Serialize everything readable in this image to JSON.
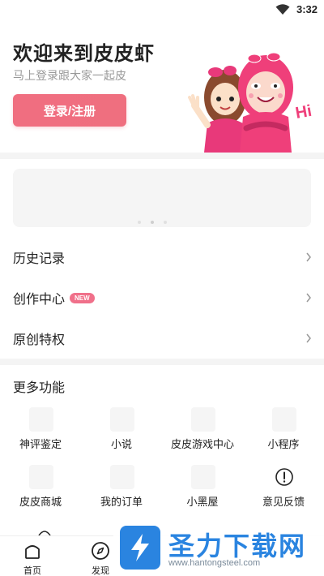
{
  "status_bar": {
    "time": "3:32",
    "wifi_icon": "wifi-icon"
  },
  "header": {
    "welcome": "欢迎来到皮皮虾",
    "subtitle": "马上登录跟大家一起皮",
    "login_button": "登录/注册",
    "mascot_hi": "Hi"
  },
  "menu": {
    "items": [
      {
        "label": "历史记录"
      },
      {
        "label": "创作中心",
        "badge": "NEW"
      },
      {
        "label": "原创特权"
      }
    ]
  },
  "more": {
    "title": "更多功能",
    "items": [
      {
        "label": "神评鉴定"
      },
      {
        "label": "小说"
      },
      {
        "label": "皮皮游戏中心"
      },
      {
        "label": "小程序"
      },
      {
        "label": "皮皮商城"
      },
      {
        "label": "我的订单"
      },
      {
        "label": "小黑屋"
      },
      {
        "label": "意见反馈",
        "icon": "exclamation-circle-icon"
      }
    ]
  },
  "bottom_nav": {
    "items": [
      {
        "label": "首页",
        "icon": "home-icon"
      },
      {
        "label": "发现",
        "icon": "compass-icon"
      }
    ]
  },
  "watermark": {
    "title": "圣力下载网",
    "url": "www.hantongsteel.com"
  },
  "colors": {
    "accent": "#f06e80",
    "watermark": "#2a84e0"
  }
}
